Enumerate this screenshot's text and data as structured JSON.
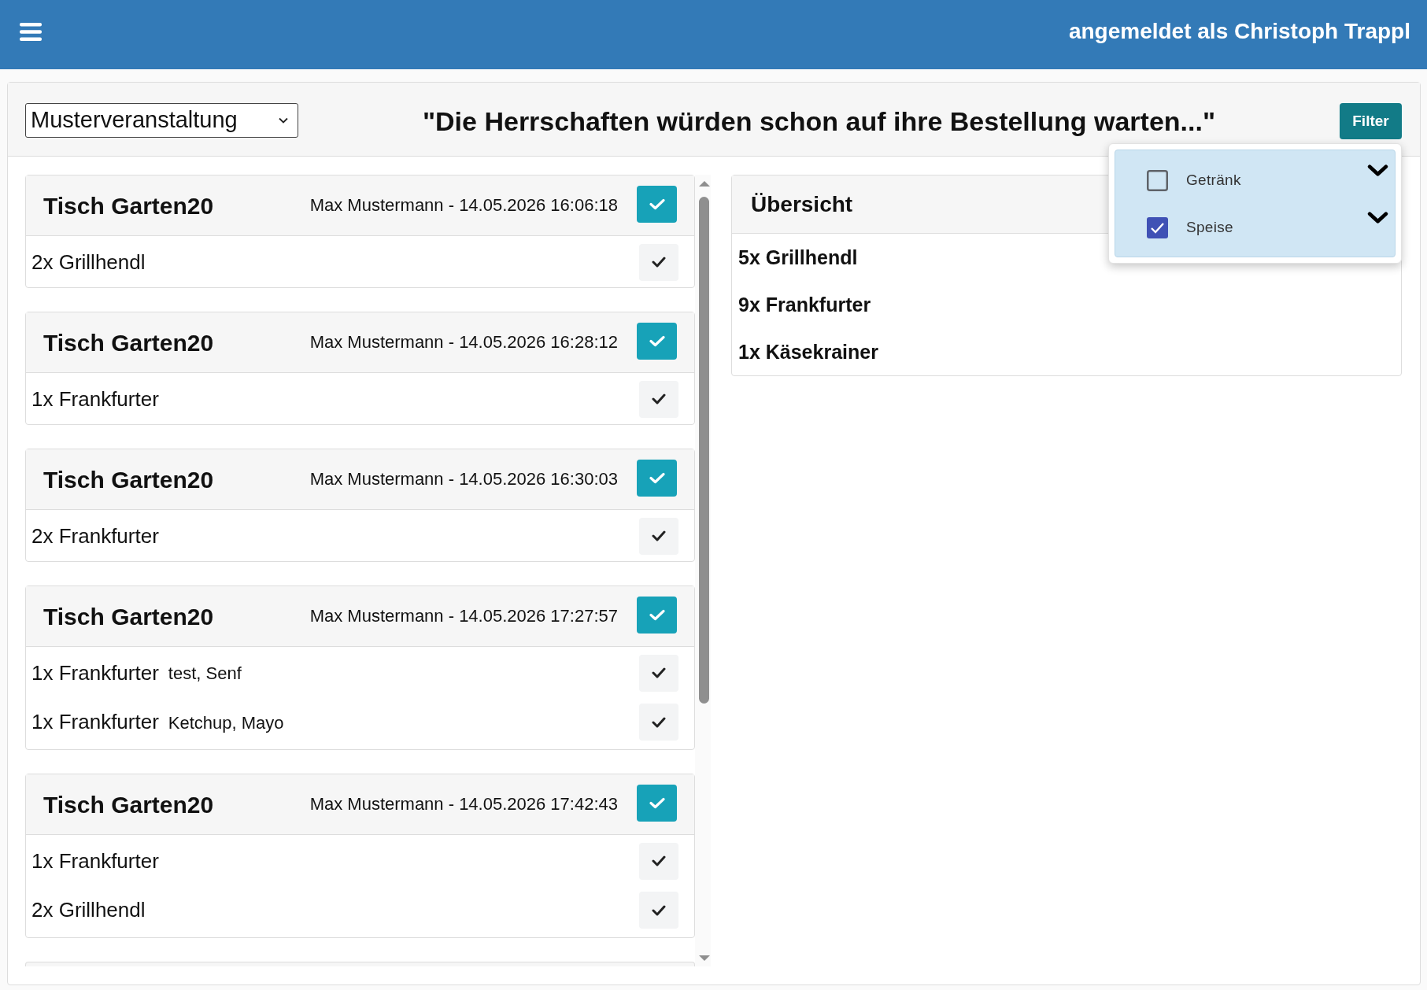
{
  "header": {
    "user_label": "angemeldet als Christoph Trappl"
  },
  "toolbar": {
    "event_select": {
      "value": "Musterveranstaltung"
    },
    "title": "\"Die Herrschaften würden schon auf ihre Bestellung warten...\"",
    "filter_button": "Filter"
  },
  "filter_menu": {
    "items": [
      {
        "label": "Getränk",
        "checked": false,
        "expanded": false
      },
      {
        "label": "Speise",
        "checked": true,
        "expanded": false
      }
    ]
  },
  "orders": [
    {
      "table": "Tisch Garten20",
      "meta": "Max Mustermann - 14.05.2026 16:06:18",
      "items": [
        {
          "name": "2x Grillhendl"
        }
      ]
    },
    {
      "table": "Tisch Garten20",
      "meta": "Max Mustermann - 14.05.2026 16:28:12",
      "items": [
        {
          "name": "1x Frankfurter"
        }
      ]
    },
    {
      "table": "Tisch Garten20",
      "meta": "Max Mustermann - 14.05.2026 16:30:03",
      "items": [
        {
          "name": "2x Frankfurter"
        }
      ]
    },
    {
      "table": "Tisch Garten20",
      "meta": "Max Mustermann - 14.05.2026 17:27:57",
      "items": [
        {
          "name": "1x Frankfurter",
          "note": "test, Senf"
        },
        {
          "name": "1x Frankfurter",
          "note": "Ketchup, Mayo"
        }
      ]
    },
    {
      "table": "Tisch Garten20",
      "meta": "Max Mustermann - 14.05.2026 17:42:43",
      "items": [
        {
          "name": "1x Frankfurter"
        },
        {
          "name": "2x Grillhendl"
        }
      ]
    }
  ],
  "orders_more_below": true,
  "overview": {
    "title": "Übersicht",
    "items": [
      "5x Grillhendl",
      "9x Frankfurter",
      "1x Käsekrainer"
    ]
  }
}
